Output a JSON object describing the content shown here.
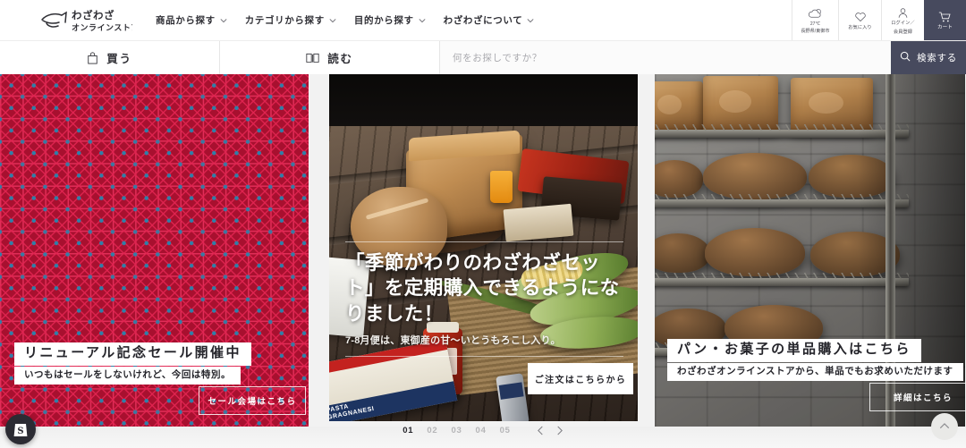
{
  "header": {
    "logo": {
      "line1": "わざわざ",
      "line2": "オンラインストア",
      "name": "wazawaza-online-store"
    },
    "nav": [
      {
        "label": "商品から探す"
      },
      {
        "label": "カテゴリから探す"
      },
      {
        "label": "目的から探す"
      },
      {
        "label": "わざわざについて"
      }
    ],
    "utilities": {
      "weather": {
        "temp": "27℃",
        "location": "長野県/東御市"
      },
      "favorites": {
        "label": "お気に入り"
      },
      "account": {
        "line1": "ログイン／",
        "line2": "会員登録"
      },
      "cart": {
        "label": "カート"
      }
    }
  },
  "subnav": {
    "tabs": [
      {
        "label": "買う",
        "icon": "bag-icon"
      },
      {
        "label": "読む",
        "icon": "book-icon"
      }
    ],
    "search": {
      "placeholder": "何をお探しですか？",
      "value": "",
      "button_label": "検索する"
    }
  },
  "carousel": {
    "slides": [
      {
        "id": "slide-sale",
        "title": "リニューアル記念セール開催中",
        "subtitle": "いつもはセールをしないけれど、今回は特別。",
        "cta": "セール会場はこちら",
        "bg_color": "#a8102f",
        "accent_color": "#2f7fa8"
      },
      {
        "id": "slide-seasonal-set",
        "title": "「季節がわりのわざわざセット」を定期購入できるようになりました！",
        "subtitle": "7-8月便は、東御産の甘〜いとうもろこし入り。",
        "cta": "ご注文はこちらから"
      },
      {
        "id": "slide-bread-sweets",
        "title": "パン・お菓子の単品購入はこちら",
        "subtitle": "わざわざオンラインストアから、単品でもお求めいただけます",
        "cta": "詳細はこちら"
      }
    ],
    "pagination": {
      "pages": [
        "01",
        "02",
        "03",
        "04",
        "05"
      ],
      "active_index": 0,
      "prev_label": "‹",
      "next_label": "›"
    }
  },
  "floating": {
    "shopify_badge": "S",
    "scroll_top": "scroll-to-top"
  },
  "pasta_pack": {
    "line1": "PASTA",
    "line2": "GRAGNANESI"
  }
}
